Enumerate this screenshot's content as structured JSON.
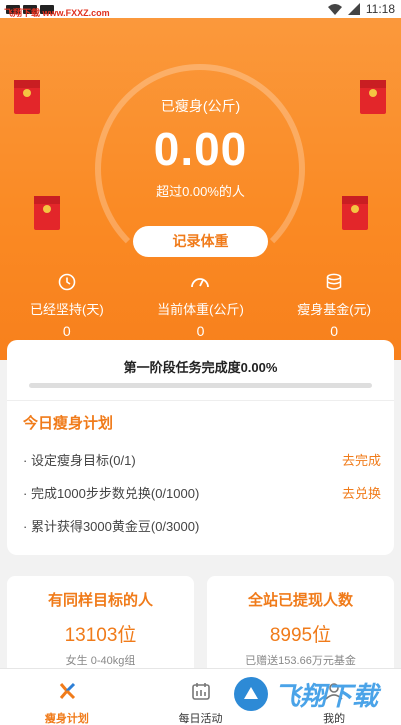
{
  "status_bar": {
    "watermark_text": "飞翔下载 www.FXXZ.com",
    "time": "11:18"
  },
  "hero": {
    "lost_label": "已瘦身(公斤)",
    "lost_value": "0.00",
    "exceed_text": "超过0.00%的人",
    "record_button": "记录体重",
    "stats": [
      {
        "icon": "clock-icon",
        "label": "已经坚持(天)",
        "value": "0"
      },
      {
        "icon": "gauge-icon",
        "label": "当前体重(公斤)",
        "value": "0"
      },
      {
        "icon": "coins-icon",
        "label": "瘦身基金(元)",
        "value": "0"
      }
    ]
  },
  "progress": {
    "title": "第一阶段任务完成度0.00%",
    "percent": 0
  },
  "plan": {
    "title": "今日瘦身计划",
    "tasks": [
      {
        "label": "· 设定瘦身目标(0/1)",
        "action": "去完成"
      },
      {
        "label": "· 完成1000步步数兑换(0/1000)",
        "action": "去兑换"
      },
      {
        "label": "· 累计获得3000黄金豆(0/3000)",
        "action": ""
      }
    ]
  },
  "cards": [
    {
      "title": "有同样目标的人",
      "value": "13103位",
      "sub": "女生  0-40kg组"
    },
    {
      "title": "全站已提现人数",
      "value": "8995位",
      "sub": "已赠送153.66万元基金"
    }
  ],
  "tabbar": {
    "tabs": [
      {
        "label": "瘦身计划",
        "active": true
      },
      {
        "label": "每日活动",
        "active": false
      },
      {
        "label": "我的",
        "active": false
      }
    ]
  },
  "colors": {
    "accent": "#f07b1a",
    "hero_top": "#fb9a3e",
    "hero_bottom": "#f8801c",
    "envelope": "#e3262a"
  },
  "bottom_watermark": {
    "text": "飞翔下载"
  }
}
